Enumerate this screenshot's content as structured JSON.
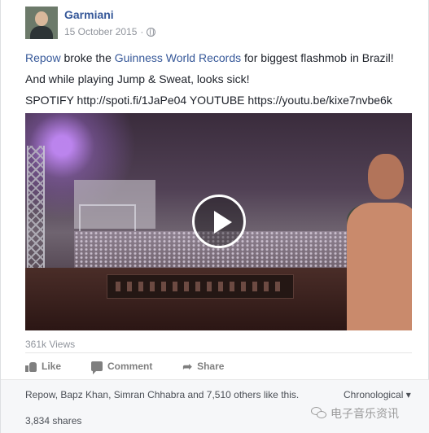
{
  "post": {
    "author": "Garmiani",
    "date": "15 October 2015",
    "text": {
      "line1_link1": "Repow",
      "line1_mid1": " broke the ",
      "line1_link2": "Guinness World Records",
      "line1_tail": " for biggest flashmob in Brazil!",
      "line2": "And while playing Jump & Sweat, looks sick!",
      "line3_label1": "SPOTIFY ",
      "line3_url1": "http://spoti.fi/1JaPe04",
      "line3_label2": " YOUTUBE ",
      "line3_url2": "https://youtu.be/kixe7nvbe6k"
    }
  },
  "video": {
    "views": "361k Views"
  },
  "actions": {
    "like": "Like",
    "comment": "Comment",
    "share": "Share"
  },
  "footer": {
    "likes_summary": "Repow, Bapz Khan, Simran Chhabra and 7,510 others like this.",
    "sort_label": "Chronological ▾",
    "shares": "3,834 shares",
    "watermark": "电子音乐资讯"
  },
  "icons": {
    "privacy": "globe-icon",
    "play": "play-icon",
    "like": "thumbs-up-icon",
    "comment": "comment-icon",
    "share": "share-arrow-icon",
    "watermark": "wechat-icon"
  }
}
